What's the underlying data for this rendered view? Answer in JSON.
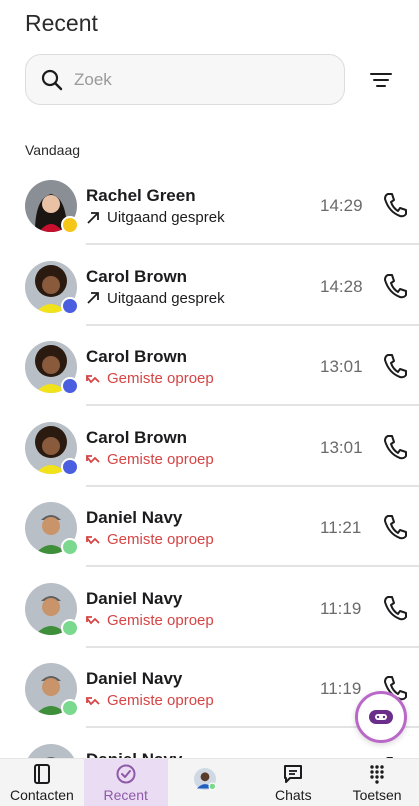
{
  "header": {
    "title": "Recent"
  },
  "search": {
    "placeholder": "Zoek",
    "value": ""
  },
  "section": {
    "label": "Vandaag"
  },
  "calls": [
    {
      "name": "Rachel Green",
      "type": "Uitgaand gesprek",
      "direction": "outgoing",
      "time": "14:29",
      "status_color": "#f5c518"
    },
    {
      "name": "Carol Brown",
      "type": "Uitgaand gesprek",
      "direction": "outgoing",
      "time": "14:28",
      "status_color": "#4a5fe0"
    },
    {
      "name": "Carol Brown",
      "type": "Gemiste oproep",
      "direction": "missed",
      "time": "13:01",
      "status_color": "#4a5fe0"
    },
    {
      "name": "Carol Brown",
      "type": "Gemiste oproep",
      "direction": "missed",
      "time": "13:01",
      "status_color": "#4a5fe0"
    },
    {
      "name": "Daniel Navy",
      "type": "Gemiste oproep",
      "direction": "missed",
      "time": "11:21",
      "status_color": "#7bd88f"
    },
    {
      "name": "Daniel Navy",
      "type": "Gemiste oproep",
      "direction": "missed",
      "time": "11:19",
      "status_color": "#7bd88f"
    },
    {
      "name": "Daniel Navy",
      "type": "Gemiste oproep",
      "direction": "missed",
      "time": "11:19",
      "status_color": "#7bd88f"
    },
    {
      "name": "Daniel Navy",
      "type": "",
      "direction": "missed",
      "time": "",
      "status_color": "#7bd88f"
    }
  ],
  "nav": {
    "contacts": "Contacten",
    "recent": "Recent",
    "chats": "Chats",
    "keypad": "Toetsen"
  },
  "colors": {
    "accent": "#8e5aa8",
    "missed": "#d64545"
  }
}
